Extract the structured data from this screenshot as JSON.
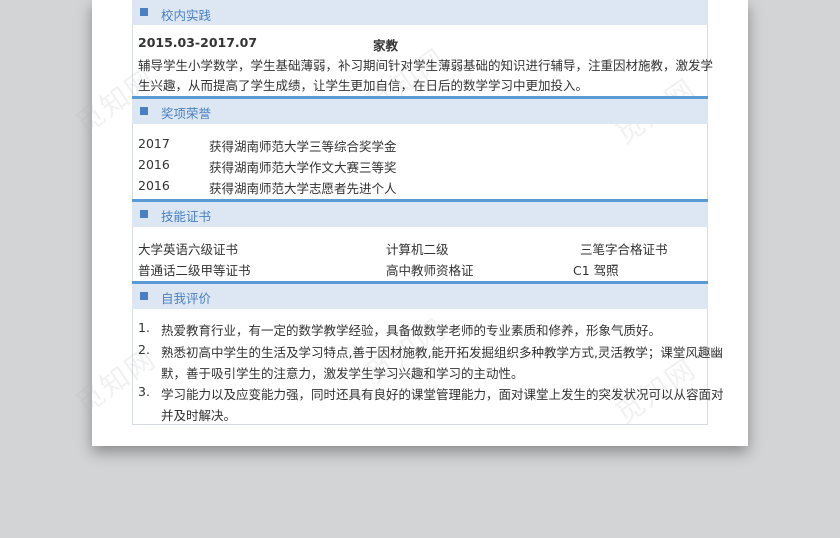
{
  "watermark": "觅知网",
  "practice": {
    "title": "校内实践",
    "period": "2015.03-2017.07",
    "role": "家教",
    "desc_line1": "辅导学生小学数学，学生基础薄弱，补习期间针对学生薄弱基础的知识进行辅导，注重因材施教，激发学",
    "desc_line2": "生兴趣，从而提高了学生成绩，让学生更加自信，在日后的数学学习中更加投入。"
  },
  "awards": {
    "title": "奖项荣誉",
    "items": [
      {
        "year": "2017",
        "text": "获得湖南师范大学三等综合奖学金"
      },
      {
        "year": "2016",
        "text": "获得湖南师范大学作文大赛三等奖"
      },
      {
        "year": "2016",
        "text": "获得湖南师范大学志愿者先进个人"
      }
    ]
  },
  "skills": {
    "title": "技能证书",
    "items": [
      "大学英语六级证书",
      "计算机二级",
      "三笔字合格证书",
      "普通话二级甲等证书",
      "高中教师资格证",
      "C1 驾照"
    ]
  },
  "self_eval": {
    "title": "自我评价",
    "items": [
      {
        "num": "1.",
        "lines": [
          "热爱教育行业，有一定的数学教学经验，具备做数学老师的专业素质和修养，形象气质好。"
        ]
      },
      {
        "num": "2.",
        "lines": [
          "熟悉初高中学生的生活及学习特点,善于因材施教,能开拓发掘组织多种教学方式,灵活教学；课堂风趣幽",
          "默，善于吸引学生的注意力，激发学生学习兴趣和学习的主动性。"
        ]
      },
      {
        "num": "3.",
        "lines": [
          "学习能力以及应变能力强，同时还具有良好的课堂管理能力，面对课堂上发生的突发状况可以从容面对",
          "并及时解决。"
        ]
      }
    ]
  }
}
